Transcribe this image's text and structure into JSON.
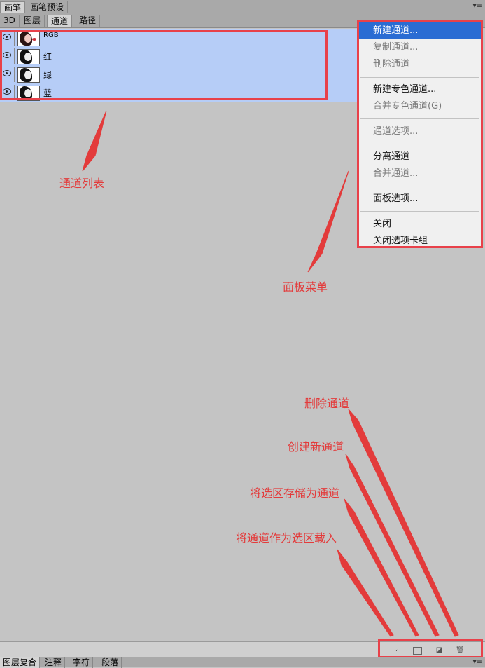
{
  "top_tabs": [
    "画笔",
    "画笔预设"
  ],
  "panel_tabs": [
    "3D",
    "图层",
    "通道",
    "路径"
  ],
  "active_panel_tab": "通道",
  "channels": [
    {
      "label": "RGB"
    },
    {
      "label": "红"
    },
    {
      "label": "绿"
    },
    {
      "label": "蓝"
    }
  ],
  "panel_menu": {
    "items": [
      {
        "label": "新建通道...",
        "state": "highlighted"
      },
      {
        "label": "复制通道...",
        "state": "disabled"
      },
      {
        "label": "删除通道",
        "state": "disabled"
      },
      {
        "label": "新建专色通道...",
        "state": "enabled"
      },
      {
        "label": "合并专色通道(G)",
        "state": "disabled"
      },
      {
        "label": "通道选项...",
        "state": "disabled"
      },
      {
        "label": "分离通道",
        "state": "enabled"
      },
      {
        "label": "合并通道...",
        "state": "disabled"
      },
      {
        "label": "面板选项...",
        "state": "enabled"
      },
      {
        "label": "关闭",
        "state": "enabled"
      },
      {
        "label": "关闭选项卡组",
        "state": "enabled"
      }
    ]
  },
  "annotations": {
    "channel_list": "通道列表",
    "panel_menu": "面板菜单",
    "delete_channel": "删除通道",
    "create_new_channel": "创建新通道",
    "save_selection_as_channel": "将选区存储为通道",
    "load_channel_as_selection": "将通道作为选区载入"
  },
  "bottom_tabs": [
    "图层复合",
    "注释",
    "字符",
    "段落"
  ],
  "colors": {
    "annotation_red": "#e33b3b",
    "highlight_blue": "#2a6cd3",
    "row_selected": "#b6cdf7"
  }
}
